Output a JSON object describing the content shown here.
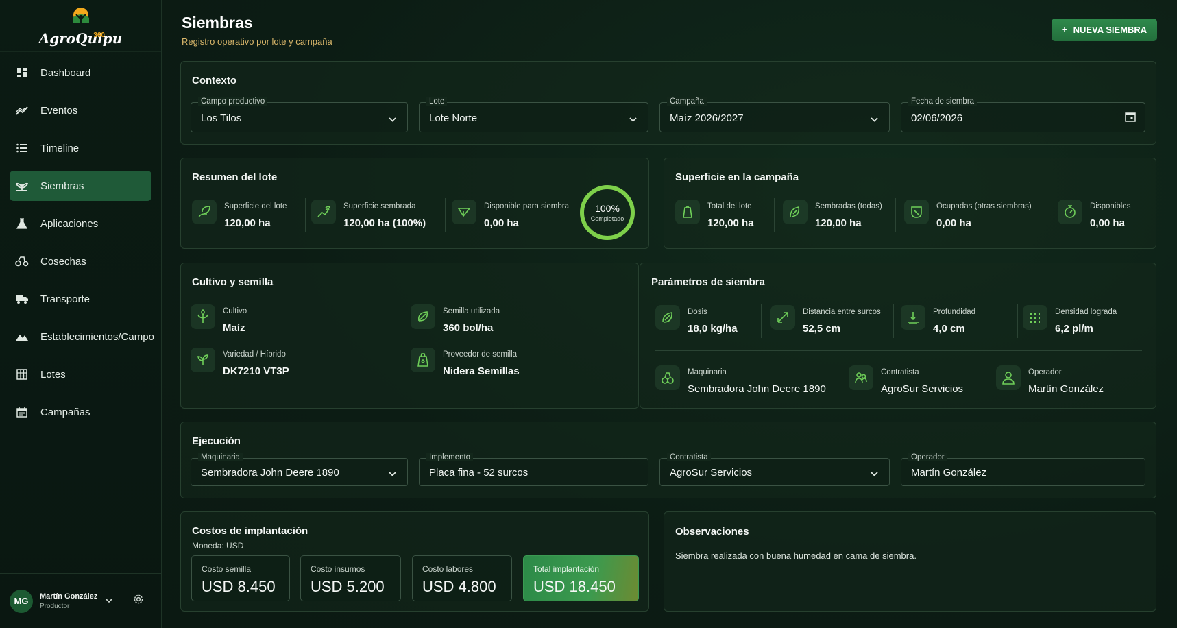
{
  "app": {
    "logo_text": "AgroQuipu",
    "logo_suffix": "360"
  },
  "sidebar": {
    "items": [
      {
        "label": "Dashboard",
        "icon": "dashboard-icon"
      },
      {
        "label": "Eventos",
        "icon": "trend-icon"
      },
      {
        "label": "Timeline",
        "icon": "list-icon"
      },
      {
        "label": "Siembras",
        "icon": "sprout-icon"
      },
      {
        "label": "Aplicaciones",
        "icon": "flask-icon"
      },
      {
        "label": "Cosechas",
        "icon": "tractor-icon"
      },
      {
        "label": "Transporte",
        "icon": "truck-icon"
      },
      {
        "label": "Establecimientos/Campo",
        "icon": "terrain-icon"
      },
      {
        "label": "Lotes",
        "icon": "grid-icon"
      },
      {
        "label": "Campañas",
        "icon": "calendar-icon"
      }
    ],
    "active": "Siembras",
    "user": {
      "initials": "MG",
      "name": "Martín González",
      "role": "Productor"
    }
  },
  "header": {
    "title": "Siembras",
    "subtitle": "Registro operativo por lote y campaña",
    "new_button": "NUEVA SIEMBRA"
  },
  "contexto": {
    "title": "Contexto",
    "campo": {
      "label": "Campo productivo",
      "value": "Los Tilos"
    },
    "lote": {
      "label": "Lote",
      "value": "Lote Norte"
    },
    "campana": {
      "label": "Campaña",
      "value": "Maíz 2026/2027"
    },
    "fecha": {
      "label": "Fecha de siembra",
      "value": "02/06/2026"
    }
  },
  "resumen": {
    "title": "Resumen del lote",
    "superficie": {
      "label": "Superficie del lote",
      "value": "120,00 ha"
    },
    "sembrada": {
      "label": "Superficie sembrada",
      "value": "120,00 ha (100%)"
    },
    "disponible": {
      "label": "Disponible para siembra",
      "value": "0,00 ha"
    },
    "progress": {
      "percent_text": "100%",
      "caption": "Completado",
      "fraction": 1.0
    }
  },
  "superficie_campana": {
    "title": "Superficie en la campaña",
    "total": {
      "label": "Total del lote",
      "value": "120,00 ha"
    },
    "sembradas": {
      "label": "Sembradas (todas)",
      "value": "120,00 ha"
    },
    "ocupadas": {
      "label": "Ocupadas (otras siembras)",
      "value": "0,00 ha"
    },
    "disponibles": {
      "label": "Disponibles",
      "value": "0,00 ha"
    }
  },
  "cultivo": {
    "title": "Cultivo y semilla",
    "cultivo": {
      "label": "Cultivo",
      "value": "Maíz"
    },
    "semilla": {
      "label": "Semilla utilizada",
      "value": "360 bol/ha"
    },
    "variedad": {
      "label": "Variedad / Híbrido",
      "value": "DK7210 VT3P"
    },
    "proveedor": {
      "label": "Proveedor de semilla",
      "value": "Nidera Semillas"
    }
  },
  "parametros": {
    "title": "Parámetros de siembra",
    "dosis": {
      "label": "Dosis",
      "value": "18,0 kg/ha"
    },
    "distancia": {
      "label": "Distancia entre surcos",
      "value": "52,5 cm"
    },
    "profundidad": {
      "label": "Profundidad",
      "value": "4,0 cm"
    },
    "densidad": {
      "label": "Densidad lograda",
      "value": "6,2 pl/m"
    },
    "maquinaria": {
      "label": "Maquinaria",
      "value": "Sembradora John Deere 1890"
    },
    "contratista": {
      "label": "Contratista",
      "value": "AgroSur Servicios"
    },
    "operador": {
      "label": "Operador",
      "value": "Martín González"
    }
  },
  "ejecucion": {
    "title": "Ejecución",
    "maquinaria": {
      "label": "Maquinaria",
      "value": "Sembradora John Deere 1890"
    },
    "implemento": {
      "label": "Implemento",
      "value": "Placa fina - 52 surcos"
    },
    "contratista": {
      "label": "Contratista",
      "value": "AgroSur Servicios"
    },
    "operador": {
      "label": "Operador",
      "value": "Martín González"
    }
  },
  "costos": {
    "title": "Costos de implantación",
    "moneda": "Moneda: USD",
    "semilla": {
      "label": "Costo semilla",
      "value": "USD 8.450"
    },
    "insumos": {
      "label": "Costo insumos",
      "value": "USD 5.200"
    },
    "labores": {
      "label": "Costo labores",
      "value": "USD 4.800"
    },
    "total": {
      "label": "Total implantación",
      "value": "USD 18.450"
    }
  },
  "observaciones": {
    "title": "Observaciones",
    "text": "Siembra realizada con buena humedad en cama de siembra."
  },
  "colors": {
    "accent": "#6fcf59",
    "active_nav": "#1f5a38",
    "button": "#2f8a4c",
    "subtitle": "#d9b66a"
  }
}
